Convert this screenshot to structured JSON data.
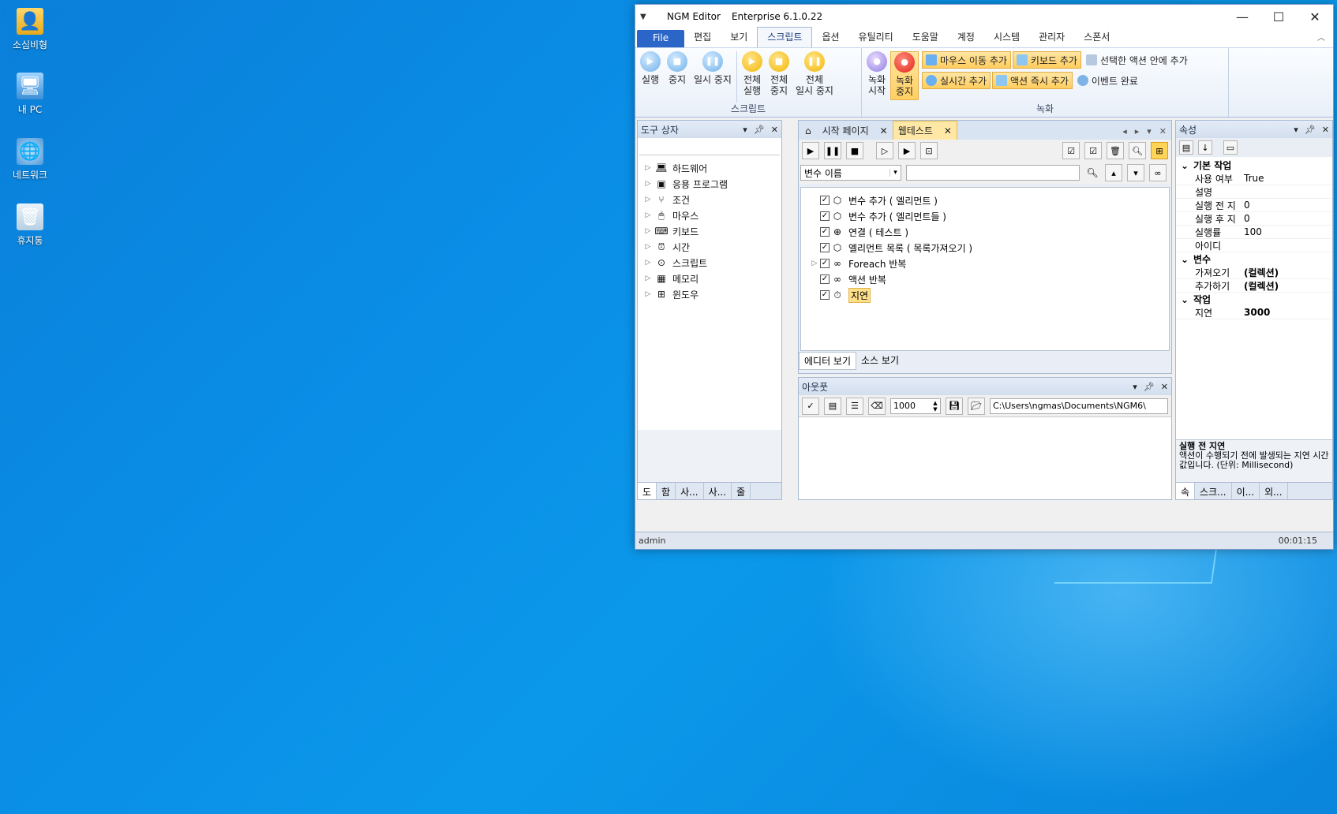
{
  "desktop": {
    "icons": [
      {
        "label": "소심비형"
      },
      {
        "label": "내 PC"
      },
      {
        "label": "네트워크"
      },
      {
        "label": "휴지통"
      }
    ]
  },
  "window": {
    "app_title": "NGM Editor",
    "edition": "Enterprise 6.1.0.22"
  },
  "menu": {
    "file": "File",
    "items": [
      "편집",
      "보기",
      "스크립트",
      "옵션",
      "유틸리티",
      "도움말",
      "계정",
      "시스템",
      "관리자",
      "스폰서"
    ]
  },
  "ribbon": {
    "script_group": {
      "caption": "스크립트",
      "run": "실행",
      "stop": "중지",
      "pause": "일시 중지",
      "run_all": "전체\n실행",
      "stop_all": "전체\n중지",
      "pause_all": "전체\n일시 중지"
    },
    "record_group": {
      "caption": "녹화",
      "record_start": "녹화\n시작",
      "record_stop": "녹화\n중지",
      "mouse_move_add": "마우스 이동 추가",
      "keyboard_add": "키보드 추가",
      "add_inside_selected": "선택한 액션 안에 추가",
      "realtime_add": "실시간 추가",
      "action_instant_add": "액션 즉시 추가",
      "event_done": "이벤트 완료"
    }
  },
  "toolbox": {
    "title": "도구 상자",
    "items": [
      "하드웨어",
      "응용 프로그램",
      "조건",
      "마우스",
      "키보드",
      "시간",
      "스크립트",
      "메모리",
      "윈도우"
    ],
    "bottom_tabs": [
      "도",
      "함",
      "사...",
      "사...",
      "줄"
    ]
  },
  "editor": {
    "tabs": [
      "시작 페이지",
      "웹테스트"
    ],
    "filter_select": "변수 이름",
    "actions": [
      "변수 추가 ( 엘리먼트 )",
      "변수 추가 ( 엘리먼트들 )",
      "연결 ( 테스트 )",
      "엘리먼트 목록 ( 목록가져오기 )",
      "Foreach 반복",
      "액션 반복",
      "지연"
    ],
    "view_tabs": [
      "에디터 보기",
      "소스 보기"
    ]
  },
  "output": {
    "title": "아웃풋",
    "count": "1000",
    "path": "C:\\Users\\ngmas\\Documents\\NGM6\\"
  },
  "properties": {
    "title": "속성",
    "categories": [
      {
        "name": "기본 작업",
        "rows": [
          [
            "사용 여부",
            "True"
          ],
          [
            "설명",
            ""
          ],
          [
            "실행 전 지",
            "0"
          ],
          [
            "실행 후 지",
            "0"
          ],
          [
            "실행률",
            "100"
          ],
          [
            "아이디",
            ""
          ]
        ]
      },
      {
        "name": "변수",
        "rows": [
          [
            "가져오기",
            "(컬렉션)"
          ],
          [
            "추가하기",
            "(컬렉션)"
          ]
        ]
      },
      {
        "name": "작업",
        "rows": [
          [
            "지연",
            "3000"
          ]
        ]
      }
    ],
    "help_title": "실행 전 지연",
    "help_text": "액션이 수행되기 전에 발생되는 지연 시간 값입니다. (단위: Millisecond)",
    "bottom_tabs": [
      "속",
      "스크...",
      "이...",
      "외..."
    ]
  },
  "status": {
    "user": "admin",
    "time": "00:01:15"
  }
}
